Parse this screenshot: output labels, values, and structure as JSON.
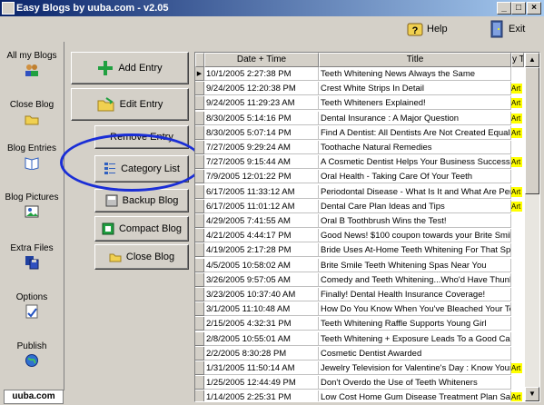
{
  "window": {
    "title": "Easy Blogs by uuba.com - v2.05",
    "min": "_",
    "max": "□",
    "close": "×"
  },
  "toolbar": {
    "help_label": "Help",
    "exit_label": "Exit"
  },
  "sidebar": {
    "items": [
      {
        "label": "All my Blogs",
        "icon": "people-icon"
      },
      {
        "label": "Close Blog",
        "icon": "folder-icon"
      },
      {
        "label": "Blog Entries",
        "icon": "book-icon"
      },
      {
        "label": "Blog Pictures",
        "icon": "picture-icon"
      },
      {
        "label": "Extra Files",
        "icon": "disk-icon"
      },
      {
        "label": "Options",
        "icon": "options-icon"
      },
      {
        "label": "Publish",
        "icon": "globe-icon"
      }
    ],
    "logo": "uuba.com"
  },
  "actions": {
    "add_entry": "Add Entry",
    "edit_entry": "Edit Entry",
    "remove_entry": "Remove Entry",
    "category_list": "Category List",
    "backup_blog": "Backup Blog",
    "compact_blog": "Compact Blog",
    "close_blog": "Close Blog"
  },
  "grid": {
    "columns": [
      "Date + Time",
      "Title",
      "y T"
    ],
    "rows": [
      {
        "date": "10/1/2005 2:27:38 PM",
        "title": "Teeth Whitening News Always the Same",
        "tag": ""
      },
      {
        "date": "9/24/2005 12:20:38 PM",
        "title": "Crest White Strips In Detail",
        "tag": "Art"
      },
      {
        "date": "9/24/2005 11:29:23 AM",
        "title": "Teeth Whiteners Explained!",
        "tag": "Art"
      },
      {
        "date": "8/30/2005 5:14:16 PM",
        "title": "Dental Insurance : A Major Question",
        "tag": "Art"
      },
      {
        "date": "8/30/2005 5:07:14 PM",
        "title": "Find A Dentist: All Dentists Are Not Created Equal Pa",
        "tag": "Art"
      },
      {
        "date": "7/27/2005 9:29:24 AM",
        "title": "Toothache Natural Remedies",
        "tag": ""
      },
      {
        "date": "7/27/2005 9:15:44 AM",
        "title": "A Cosmetic Dentist Helps Your Business Success",
        "tag": "Art"
      },
      {
        "date": "7/9/2005 12:01:22 PM",
        "title": "Oral Health - Taking Care Of Your Teeth",
        "tag": ""
      },
      {
        "date": "6/17/2005 11:33:12 AM",
        "title": "Periodontal Disease - What Is It and What Are Perio",
        "tag": "Art"
      },
      {
        "date": "6/17/2005 11:01:12 AM",
        "title": "Dental Care Plan Ideas and Tips",
        "tag": "Art"
      },
      {
        "date": "4/29/2005 7:41:55 AM",
        "title": "Oral B Toothbrush Wins the Test!",
        "tag": ""
      },
      {
        "date": "4/21/2005 4:44:17 PM",
        "title": "Good News! $100 coupon towards your Brite Smile S",
        "tag": ""
      },
      {
        "date": "4/19/2005 2:17:28 PM",
        "title": "Bride Uses  At-Home Teeth Whitening For That Spec",
        "tag": ""
      },
      {
        "date": "4/5/2005 10:58:02 AM",
        "title": "Brite Smile Teeth Whitening Spas Near You",
        "tag": ""
      },
      {
        "date": "3/26/2005 9:57:05 AM",
        "title": "Comedy and Teeth Whitening...Who'd Have Thunk",
        "tag": ""
      },
      {
        "date": "3/23/2005 10:37:40 AM",
        "title": "Finally! Dental Health Insurance Coverage!",
        "tag": ""
      },
      {
        "date": "3/1/2005 11:10:48 AM",
        "title": "How Do You Know When You've Bleached Your Te",
        "tag": ""
      },
      {
        "date": "2/15/2005 4:32:31 PM",
        "title": "Teeth Whitening Raffle Supports Young Girl",
        "tag": ""
      },
      {
        "date": "2/8/2005 10:55:01 AM",
        "title": "Teeth Whitening + Exposure Leads To a Good Cause",
        "tag": ""
      },
      {
        "date": "2/2/2005 8:30:28 PM",
        "title": "Cosmetic Dentist Awarded",
        "tag": ""
      },
      {
        "date": "1/31/2005 11:50:14 AM",
        "title": "Jewelry Television for Valentine's Day : Know Your G",
        "tag": "Art"
      },
      {
        "date": "1/25/2005 12:44:49 PM",
        "title": "Don't Overdo the Use of Teeth Whiteners",
        "tag": ""
      },
      {
        "date": "1/14/2005 2:25:31 PM",
        "title": " Low Cost Home Gum Disease Treatment Plan Save",
        "tag": "Art"
      }
    ]
  },
  "colors": {
    "titlebar": "#0a246a",
    "highlight_ellipse": "#1a2ed6",
    "tag": "#ffff00"
  }
}
